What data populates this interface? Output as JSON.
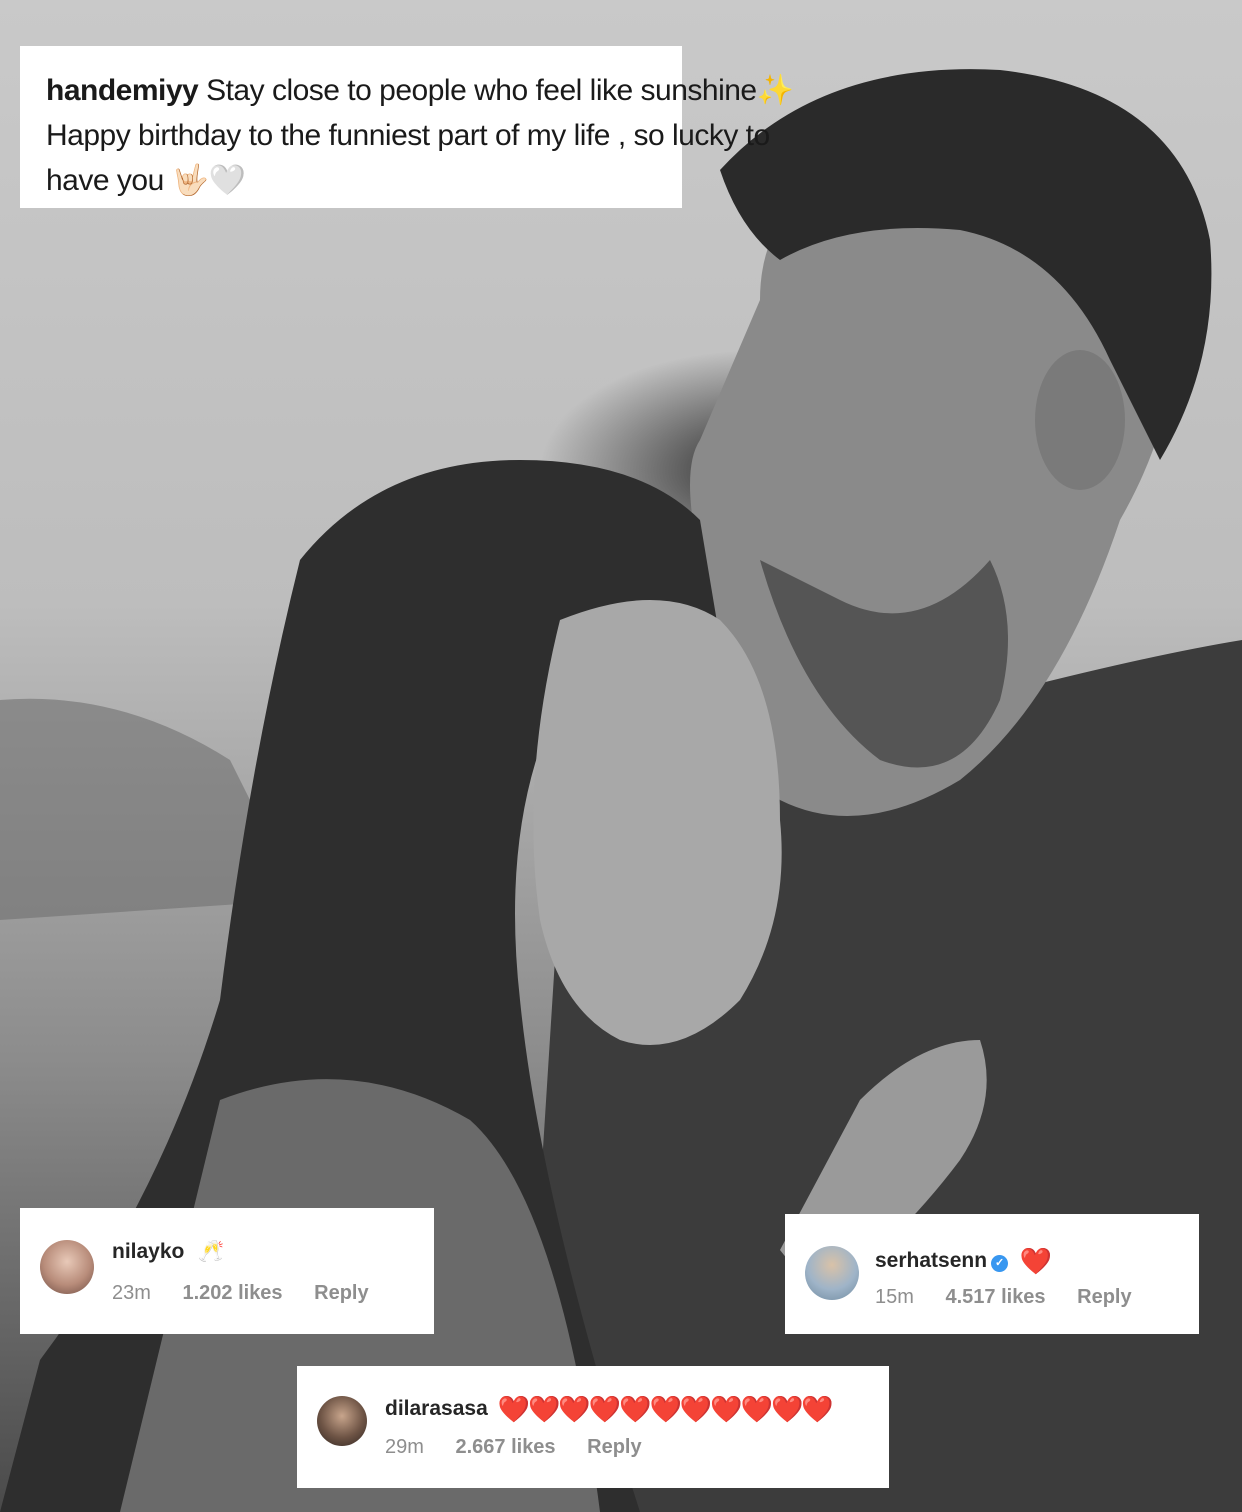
{
  "caption": {
    "username": "handemiyy",
    "line1": "Stay close to people who feel like sunshine",
    "line1_emoji": "✨",
    "line2": "Happy birthday to the funniest part of my life , so lucky to",
    "line3": "have you",
    "line3_emoji": "🤟🏻🤍"
  },
  "comments": [
    {
      "username": "nilayko",
      "text": "🥂",
      "time": "23m",
      "likes": "1.202 likes",
      "reply": "Reply"
    },
    {
      "username": "serhatsenn",
      "text": "❤️",
      "time": "15m",
      "likes": "4.517 likes",
      "reply": "Reply",
      "verified": true
    },
    {
      "username": "dilarasasa",
      "text": "❤️❤️❤️❤️❤️❤️❤️❤️❤️❤️❤️",
      "time": "29m",
      "likes": "2.667 likes",
      "reply": "Reply"
    }
  ]
}
